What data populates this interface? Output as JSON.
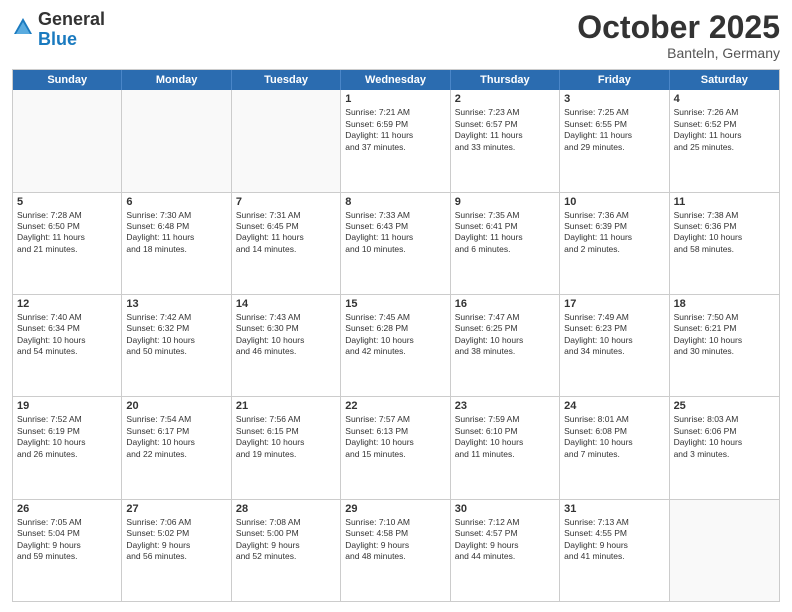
{
  "logo": {
    "general": "General",
    "blue": "Blue"
  },
  "header": {
    "month": "October 2025",
    "location": "Banteln, Germany"
  },
  "days": [
    "Sunday",
    "Monday",
    "Tuesday",
    "Wednesday",
    "Thursday",
    "Friday",
    "Saturday"
  ],
  "rows": [
    [
      {
        "day": "",
        "lines": []
      },
      {
        "day": "",
        "lines": []
      },
      {
        "day": "",
        "lines": []
      },
      {
        "day": "1",
        "lines": [
          "Sunrise: 7:21 AM",
          "Sunset: 6:59 PM",
          "Daylight: 11 hours",
          "and 37 minutes."
        ]
      },
      {
        "day": "2",
        "lines": [
          "Sunrise: 7:23 AM",
          "Sunset: 6:57 PM",
          "Daylight: 11 hours",
          "and 33 minutes."
        ]
      },
      {
        "day": "3",
        "lines": [
          "Sunrise: 7:25 AM",
          "Sunset: 6:55 PM",
          "Daylight: 11 hours",
          "and 29 minutes."
        ]
      },
      {
        "day": "4",
        "lines": [
          "Sunrise: 7:26 AM",
          "Sunset: 6:52 PM",
          "Daylight: 11 hours",
          "and 25 minutes."
        ]
      }
    ],
    [
      {
        "day": "5",
        "lines": [
          "Sunrise: 7:28 AM",
          "Sunset: 6:50 PM",
          "Daylight: 11 hours",
          "and 21 minutes."
        ]
      },
      {
        "day": "6",
        "lines": [
          "Sunrise: 7:30 AM",
          "Sunset: 6:48 PM",
          "Daylight: 11 hours",
          "and 18 minutes."
        ]
      },
      {
        "day": "7",
        "lines": [
          "Sunrise: 7:31 AM",
          "Sunset: 6:45 PM",
          "Daylight: 11 hours",
          "and 14 minutes."
        ]
      },
      {
        "day": "8",
        "lines": [
          "Sunrise: 7:33 AM",
          "Sunset: 6:43 PM",
          "Daylight: 11 hours",
          "and 10 minutes."
        ]
      },
      {
        "day": "9",
        "lines": [
          "Sunrise: 7:35 AM",
          "Sunset: 6:41 PM",
          "Daylight: 11 hours",
          "and 6 minutes."
        ]
      },
      {
        "day": "10",
        "lines": [
          "Sunrise: 7:36 AM",
          "Sunset: 6:39 PM",
          "Daylight: 11 hours",
          "and 2 minutes."
        ]
      },
      {
        "day": "11",
        "lines": [
          "Sunrise: 7:38 AM",
          "Sunset: 6:36 PM",
          "Daylight: 10 hours",
          "and 58 minutes."
        ]
      }
    ],
    [
      {
        "day": "12",
        "lines": [
          "Sunrise: 7:40 AM",
          "Sunset: 6:34 PM",
          "Daylight: 10 hours",
          "and 54 minutes."
        ]
      },
      {
        "day": "13",
        "lines": [
          "Sunrise: 7:42 AM",
          "Sunset: 6:32 PM",
          "Daylight: 10 hours",
          "and 50 minutes."
        ]
      },
      {
        "day": "14",
        "lines": [
          "Sunrise: 7:43 AM",
          "Sunset: 6:30 PM",
          "Daylight: 10 hours",
          "and 46 minutes."
        ]
      },
      {
        "day": "15",
        "lines": [
          "Sunrise: 7:45 AM",
          "Sunset: 6:28 PM",
          "Daylight: 10 hours",
          "and 42 minutes."
        ]
      },
      {
        "day": "16",
        "lines": [
          "Sunrise: 7:47 AM",
          "Sunset: 6:25 PM",
          "Daylight: 10 hours",
          "and 38 minutes."
        ]
      },
      {
        "day": "17",
        "lines": [
          "Sunrise: 7:49 AM",
          "Sunset: 6:23 PM",
          "Daylight: 10 hours",
          "and 34 minutes."
        ]
      },
      {
        "day": "18",
        "lines": [
          "Sunrise: 7:50 AM",
          "Sunset: 6:21 PM",
          "Daylight: 10 hours",
          "and 30 minutes."
        ]
      }
    ],
    [
      {
        "day": "19",
        "lines": [
          "Sunrise: 7:52 AM",
          "Sunset: 6:19 PM",
          "Daylight: 10 hours",
          "and 26 minutes."
        ]
      },
      {
        "day": "20",
        "lines": [
          "Sunrise: 7:54 AM",
          "Sunset: 6:17 PM",
          "Daylight: 10 hours",
          "and 22 minutes."
        ]
      },
      {
        "day": "21",
        "lines": [
          "Sunrise: 7:56 AM",
          "Sunset: 6:15 PM",
          "Daylight: 10 hours",
          "and 19 minutes."
        ]
      },
      {
        "day": "22",
        "lines": [
          "Sunrise: 7:57 AM",
          "Sunset: 6:13 PM",
          "Daylight: 10 hours",
          "and 15 minutes."
        ]
      },
      {
        "day": "23",
        "lines": [
          "Sunrise: 7:59 AM",
          "Sunset: 6:10 PM",
          "Daylight: 10 hours",
          "and 11 minutes."
        ]
      },
      {
        "day": "24",
        "lines": [
          "Sunrise: 8:01 AM",
          "Sunset: 6:08 PM",
          "Daylight: 10 hours",
          "and 7 minutes."
        ]
      },
      {
        "day": "25",
        "lines": [
          "Sunrise: 8:03 AM",
          "Sunset: 6:06 PM",
          "Daylight: 10 hours",
          "and 3 minutes."
        ]
      }
    ],
    [
      {
        "day": "26",
        "lines": [
          "Sunrise: 7:05 AM",
          "Sunset: 5:04 PM",
          "Daylight: 9 hours",
          "and 59 minutes."
        ]
      },
      {
        "day": "27",
        "lines": [
          "Sunrise: 7:06 AM",
          "Sunset: 5:02 PM",
          "Daylight: 9 hours",
          "and 56 minutes."
        ]
      },
      {
        "day": "28",
        "lines": [
          "Sunrise: 7:08 AM",
          "Sunset: 5:00 PM",
          "Daylight: 9 hours",
          "and 52 minutes."
        ]
      },
      {
        "day": "29",
        "lines": [
          "Sunrise: 7:10 AM",
          "Sunset: 4:58 PM",
          "Daylight: 9 hours",
          "and 48 minutes."
        ]
      },
      {
        "day": "30",
        "lines": [
          "Sunrise: 7:12 AM",
          "Sunset: 4:57 PM",
          "Daylight: 9 hours",
          "and 44 minutes."
        ]
      },
      {
        "day": "31",
        "lines": [
          "Sunrise: 7:13 AM",
          "Sunset: 4:55 PM",
          "Daylight: 9 hours",
          "and 41 minutes."
        ]
      },
      {
        "day": "",
        "lines": []
      }
    ]
  ]
}
